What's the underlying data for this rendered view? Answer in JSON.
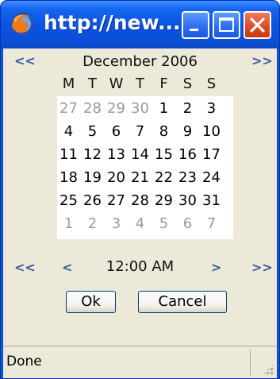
{
  "window": {
    "title": "http://new...",
    "status": "Done"
  },
  "calendar": {
    "prev_month": "<<",
    "month_year": "December 2006",
    "next_month": ">>",
    "weekdays": [
      "M",
      "T",
      "W",
      "T",
      "F",
      "S",
      "S"
    ],
    "weeks": [
      [
        {
          "d": "27",
          "o": true
        },
        {
          "d": "28",
          "o": true
        },
        {
          "d": "29",
          "o": true
        },
        {
          "d": "30",
          "o": true
        },
        {
          "d": "1",
          "o": false
        },
        {
          "d": "2",
          "o": false
        },
        {
          "d": "3",
          "o": false
        }
      ],
      [
        {
          "d": "4",
          "o": false
        },
        {
          "d": "5",
          "o": false
        },
        {
          "d": "6",
          "o": false
        },
        {
          "d": "7",
          "o": false
        },
        {
          "d": "8",
          "o": false
        },
        {
          "d": "9",
          "o": false
        },
        {
          "d": "10",
          "o": false
        }
      ],
      [
        {
          "d": "11",
          "o": false
        },
        {
          "d": "12",
          "o": false
        },
        {
          "d": "13",
          "o": false
        },
        {
          "d": "14",
          "o": false
        },
        {
          "d": "15",
          "o": false
        },
        {
          "d": "16",
          "o": false
        },
        {
          "d": "17",
          "o": false
        }
      ],
      [
        {
          "d": "18",
          "o": false
        },
        {
          "d": "19",
          "o": false
        },
        {
          "d": "20",
          "o": false
        },
        {
          "d": "21",
          "o": false
        },
        {
          "d": "22",
          "o": false
        },
        {
          "d": "23",
          "o": false
        },
        {
          "d": "24",
          "o": false
        }
      ],
      [
        {
          "d": "25",
          "o": false
        },
        {
          "d": "26",
          "o": false
        },
        {
          "d": "27",
          "o": false
        },
        {
          "d": "28",
          "o": false
        },
        {
          "d": "29",
          "o": false
        },
        {
          "d": "30",
          "o": false
        },
        {
          "d": "31",
          "o": false
        }
      ],
      [
        {
          "d": "1",
          "o": true
        },
        {
          "d": "2",
          "o": true
        },
        {
          "d": "3",
          "o": true
        },
        {
          "d": "4",
          "o": true
        },
        {
          "d": "5",
          "o": true
        },
        {
          "d": "6",
          "o": true
        },
        {
          "d": "7",
          "o": true
        }
      ]
    ]
  },
  "time": {
    "back_big": "<<",
    "back": "<",
    "value": "12:00 AM",
    "forward": ">",
    "forward_big": ">>"
  },
  "buttons": {
    "ok": "Ok",
    "cancel": "Cancel"
  }
}
